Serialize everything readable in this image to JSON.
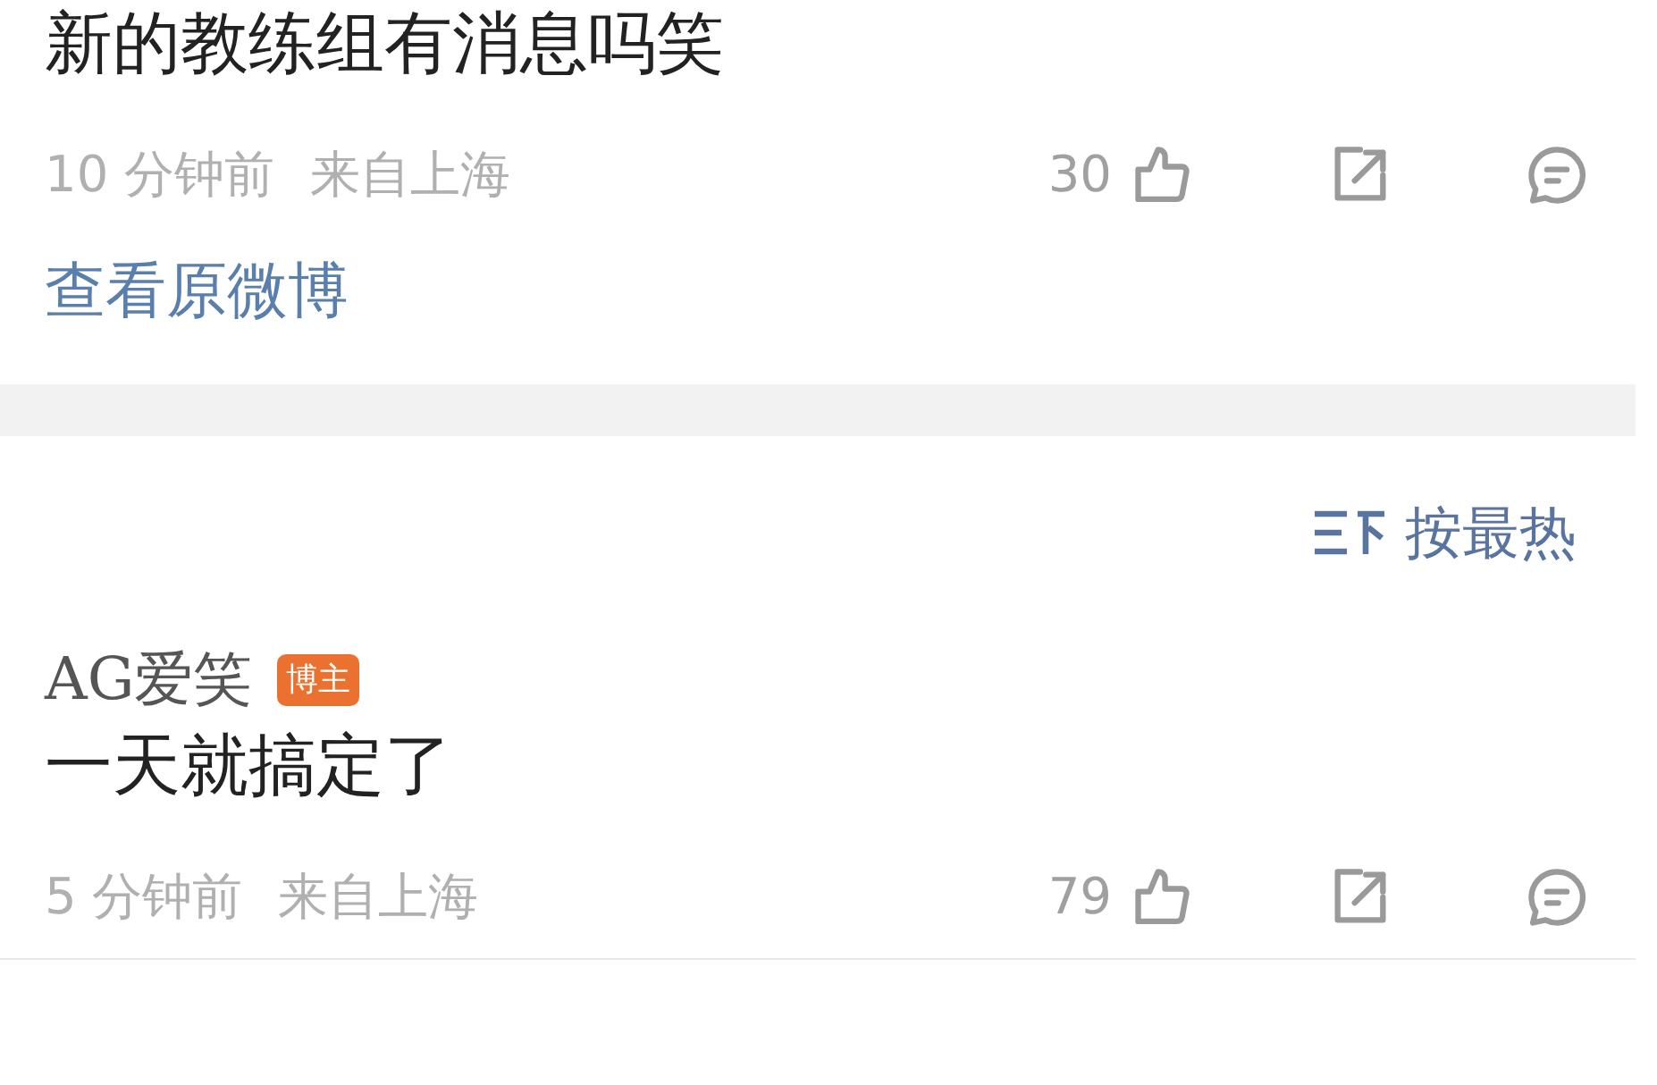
{
  "comments": [
    {
      "kind": "comment",
      "text": "新的教练组有消息吗笑",
      "time": "10 分钟前",
      "location": "来自上海",
      "likes": "30",
      "link": "查看原微博"
    },
    {
      "kind": "divider"
    },
    {
      "kind": "sort",
      "label": "按最热"
    },
    {
      "kind": "comment",
      "author": "AG爱笑",
      "badge": "博主",
      "text": "一天就搞定了",
      "time": "5 分钟前",
      "location": "来自上海",
      "likes": "79"
    }
  ]
}
